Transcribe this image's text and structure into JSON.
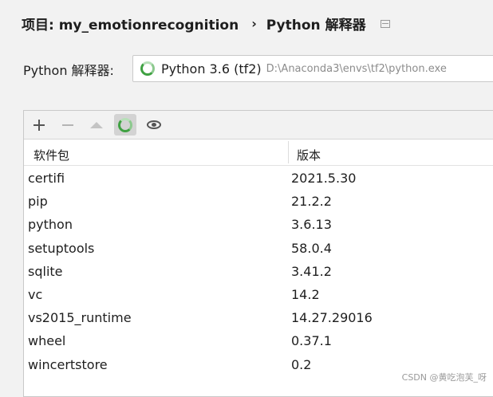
{
  "breadcrumb": {
    "project": "项目: my_emotionrecognition",
    "separator": "›",
    "page": "Python 解释器",
    "expand_icon": "window-icon"
  },
  "interpreter": {
    "label": "Python 解释器:",
    "selected_name": "Python 3.6 (tf2)",
    "selected_path": "D:\\Anaconda3\\envs\\tf2\\python.exe",
    "status_icon": "spinner-icon",
    "status_color": "#3fa142"
  },
  "toolbar": {
    "buttons": [
      {
        "icon": "plus-icon",
        "enabled": true
      },
      {
        "icon": "minus-icon",
        "enabled": false
      },
      {
        "icon": "arrow-up-icon",
        "enabled": false
      },
      {
        "icon": "spinner-icon",
        "active": true
      },
      {
        "icon": "eye-icon",
        "enabled": true
      }
    ]
  },
  "table": {
    "columns": [
      "软件包",
      "版本"
    ],
    "rows": [
      {
        "package": "certifi",
        "version": "2021.5.30"
      },
      {
        "package": "pip",
        "version": "21.2.2"
      },
      {
        "package": "python",
        "version": "3.6.13"
      },
      {
        "package": "setuptools",
        "version": "58.0.4"
      },
      {
        "package": "sqlite",
        "version": "3.41.2"
      },
      {
        "package": "vc",
        "version": "14.2"
      },
      {
        "package": "vs2015_runtime",
        "version": "14.27.29016"
      },
      {
        "package": "wheel",
        "version": "0.37.1"
      },
      {
        "package": "wincertstore",
        "version": "0.2"
      }
    ]
  },
  "watermark": "CSDN @黄吃泡芙_呀"
}
